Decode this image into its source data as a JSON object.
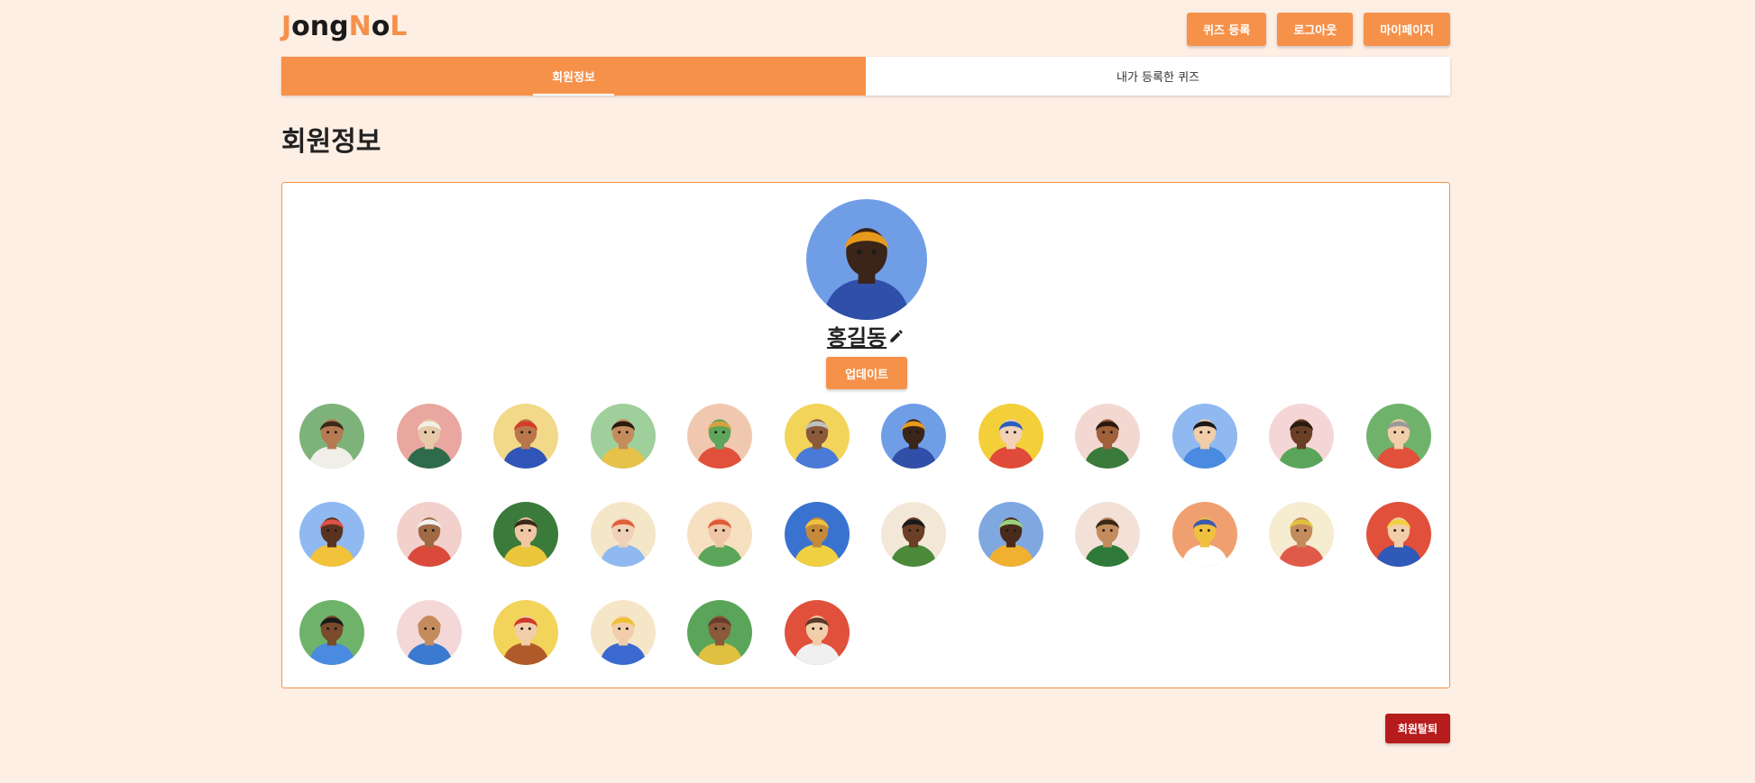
{
  "header": {
    "logo_letters": [
      "J",
      "ong",
      "N",
      "o",
      "L"
    ],
    "buttons": {
      "register_quiz": "퀴즈 등록",
      "logout": "로그아웃",
      "mypage": "마이페이지"
    }
  },
  "tabs": [
    {
      "label": "회원정보",
      "active": true
    },
    {
      "label": "내가 등록한 퀴즈",
      "active": false
    }
  ],
  "page_title": "회원정보",
  "profile": {
    "name": "홍길동",
    "update_label": "업데이트",
    "avatar": {
      "bg": "#6f9ee6",
      "skin": "#3b2418",
      "hair": "#e69a1c",
      "shirt": "#2f4fa8"
    }
  },
  "avatars": [
    {
      "bg": "#7db37a",
      "skin": "#b57a52",
      "hair": "#3a2a1a",
      "shirt": "#f0efe8"
    },
    {
      "bg": "#e9a7a0",
      "skin": "#e7c9a8",
      "hair": "#f3f0e6",
      "shirt": "#2e6b4a"
    },
    {
      "bg": "#f2d98a",
      "skin": "#b9764a",
      "hair": "#d63b2a",
      "shirt": "#2f55b8"
    },
    {
      "bg": "#9fcf9a",
      "skin": "#c48b5c",
      "hair": "#2a1a10",
      "shirt": "#e7c24a"
    },
    {
      "bg": "#f0c8b0",
      "skin": "#5ea55b",
      "hair": "#d9a040",
      "shirt": "#e0503a"
    },
    {
      "bg": "#f2d45a",
      "skin": "#8a5a3a",
      "hair": "#c0c0c0",
      "shirt": "#4a7ad8"
    },
    {
      "bg": "#6f9ee6",
      "skin": "#3b2418",
      "hair": "#e69a1c",
      "shirt": "#2f4fa8"
    },
    {
      "bg": "#f3cf3a",
      "skin": "#f1d2b8",
      "hair": "#2a5fc0",
      "shirt": "#e04a3a"
    },
    {
      "bg": "#f3d8d2",
      "skin": "#a0603a",
      "hair": "#2a1a10",
      "shirt": "#3a7a3a"
    },
    {
      "bg": "#8fb9f0",
      "skin": "#f1cda9",
      "hair": "#1a1a1a",
      "shirt": "#4a8ae0"
    },
    {
      "bg": "#f5d6d6",
      "skin": "#6b3f25",
      "hair": "#2a1a10",
      "shirt": "#5aa55a"
    },
    {
      "bg": "#6fb36a",
      "skin": "#f1cda9",
      "hair": "#9a9a9a",
      "shirt": "#e0503a"
    },
    {
      "bg": "#8fb9f0",
      "skin": "#5a3320",
      "hair": "#e0504a",
      "shirt": "#f2c23a"
    },
    {
      "bg": "#f2d0cc",
      "skin": "#a06a45",
      "hair": "#f0f0f0",
      "shirt": "#d94a3a"
    },
    {
      "bg": "#3a7a3a",
      "skin": "#f1c6a4",
      "hair": "#3a2a1a",
      "shirt": "#e9c63a"
    },
    {
      "bg": "#f4e7c8",
      "skin": "#f1d2b8",
      "hair": "#e0603a",
      "shirt": "#8fb9f0"
    },
    {
      "bg": "#f6e0c0",
      "skin": "#f1c6a4",
      "hair": "#e05a3a",
      "shirt": "#5aa55a"
    },
    {
      "bg": "#3a72d0",
      "skin": "#c48a3a",
      "hair": "#f0c040",
      "shirt": "#f0d040"
    },
    {
      "bg": "#f3e7d8",
      "skin": "#6b3f25",
      "hair": "#1a1a1a",
      "shirt": "#4a8a3a"
    },
    {
      "bg": "#7fa8e0",
      "skin": "#4a2a1a",
      "hair": "#9ad07a",
      "shirt": "#f0b030"
    },
    {
      "bg": "#f3e1d8",
      "skin": "#c48b5c",
      "hair": "#3a2a1a",
      "shirt": "#2f7a3a"
    },
    {
      "bg": "#f0a070",
      "skin": "#f0c040",
      "hair": "#3a5ab0",
      "shirt": "#ffffff"
    },
    {
      "bg": "#f6ecd0",
      "skin": "#c48b5c",
      "hair": "#e0c040",
      "shirt": "#e05a4a"
    },
    {
      "bg": "#e0503a",
      "skin": "#f1cda9",
      "hair": "#f0d040",
      "shirt": "#2f5ab8"
    },
    {
      "bg": "#6fb36a",
      "skin": "#7a4a2a",
      "hair": "#1a1a1a",
      "shirt": "#4a8ae0"
    },
    {
      "bg": "#f4d8d8",
      "skin": "#c48b5c",
      "hair": "#c48b5c",
      "shirt": "#3a7ad0"
    },
    {
      "bg": "#f2d45a",
      "skin": "#f1cda9",
      "hair": "#d03a2a",
      "shirt": "#b05a2a"
    },
    {
      "bg": "#f6e6c8",
      "skin": "#f1cda9",
      "hair": "#f0c030",
      "shirt": "#3a6ad0"
    },
    {
      "bg": "#5aa55a",
      "skin": "#8a5a3a",
      "hair": "#6a3a2a",
      "shirt": "#e0c040"
    },
    {
      "bg": "#e0503a",
      "skin": "#f1cda9",
      "hair": "#5a3a2a",
      "shirt": "#f0f0f0"
    }
  ],
  "withdraw_label": "회원탈퇴",
  "colors": {
    "accent": "#f6914a",
    "page_bg": "#feefe5",
    "danger": "#b71c1c"
  },
  "icons": {
    "edit": "pencil-icon"
  }
}
